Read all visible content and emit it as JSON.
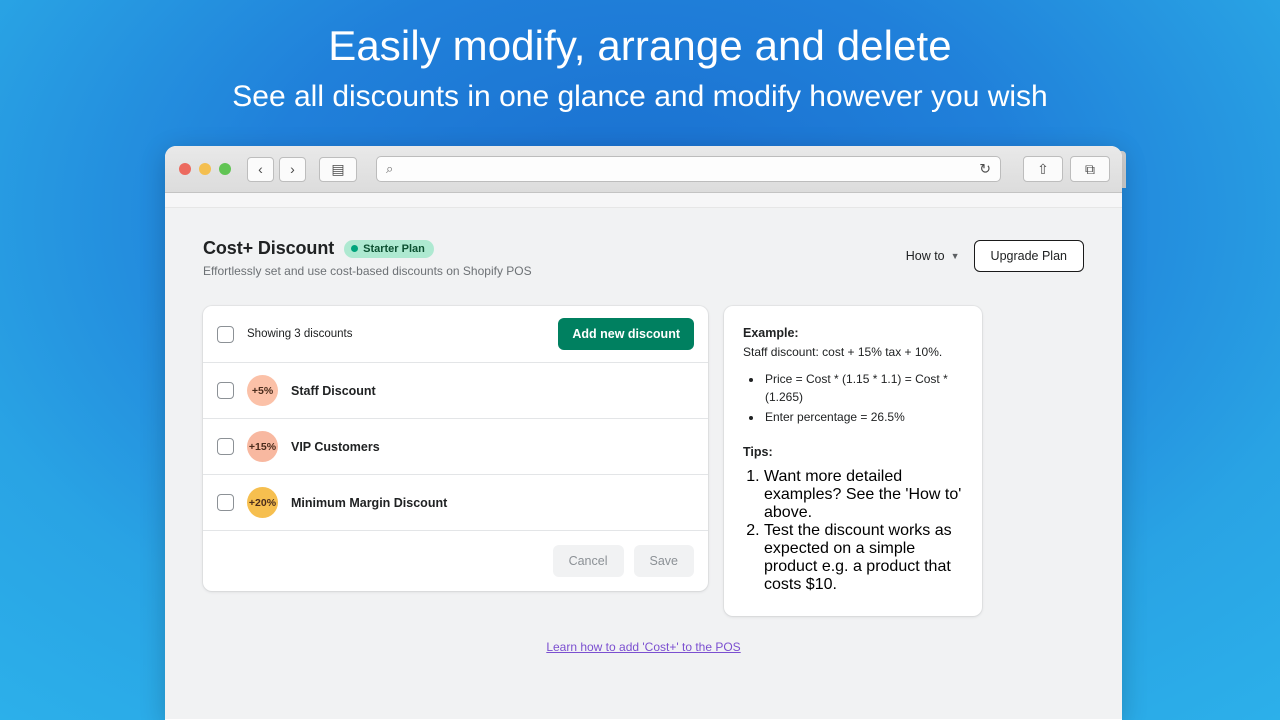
{
  "promo": {
    "title": "Easily modify, arrange and delete",
    "subtitle": "See all discounts in one glance and modify however you wish"
  },
  "browser": {
    "traffic_lights": [
      "close",
      "minimize",
      "zoom"
    ],
    "back_icon": "‹",
    "forward_icon": "›",
    "sidebar_icon": "▤",
    "search_icon": "⌕",
    "reload_icon": "↻",
    "share_icon": "⇧",
    "tabs_icon": "⧉",
    "new_tab_icon": "+",
    "url_value": "",
    "url_placeholder": ""
  },
  "page": {
    "title": "Cost+ Discount",
    "plan_badge": "Starter Plan",
    "subtitle": "Effortlessly set and use cost-based discounts on Shopify POS",
    "how_to_label": "How to",
    "how_to_chevron": "▼",
    "upgrade_label": "Upgrade Plan"
  },
  "list": {
    "showing_text": "Showing 3 discounts",
    "add_button": "Add new discount",
    "cancel_button": "Cancel",
    "save_button": "Save",
    "rows": [
      {
        "percent": "+5%",
        "name": "Staff Discount",
        "color": "#fbc1a8"
      },
      {
        "percent": "+15%",
        "name": "VIP Customers",
        "color": "#f8b8a0"
      },
      {
        "percent": "+20%",
        "name": "Minimum Margin Discount",
        "color": "#f6bf4f"
      }
    ]
  },
  "info": {
    "example_heading": "Example:",
    "example_text": "Staff discount: cost + 15% tax + 10%.",
    "example_bullets": [
      "Price = Cost * (1.15 * 1.1) = Cost * (1.265)",
      "Enter percentage = 26.5%"
    ],
    "tips_heading": "Tips:",
    "tips_items": [
      "Want more detailed examples? See the 'How to' above.",
      "Test the discount works as expected on a simple product e.g. a product that costs $10."
    ]
  },
  "footer": {
    "learn_link": "Learn how to add 'Cost+' to the POS"
  },
  "colors": {
    "brand_green": "#008060",
    "badge_green_bg": "#aee9d1",
    "badge_green_dot": "#00a47c",
    "link_purple": "#7b4fd0",
    "backdrop_blue": "#29abe8",
    "backdrop_blue_center": "#1a6fcf"
  }
}
